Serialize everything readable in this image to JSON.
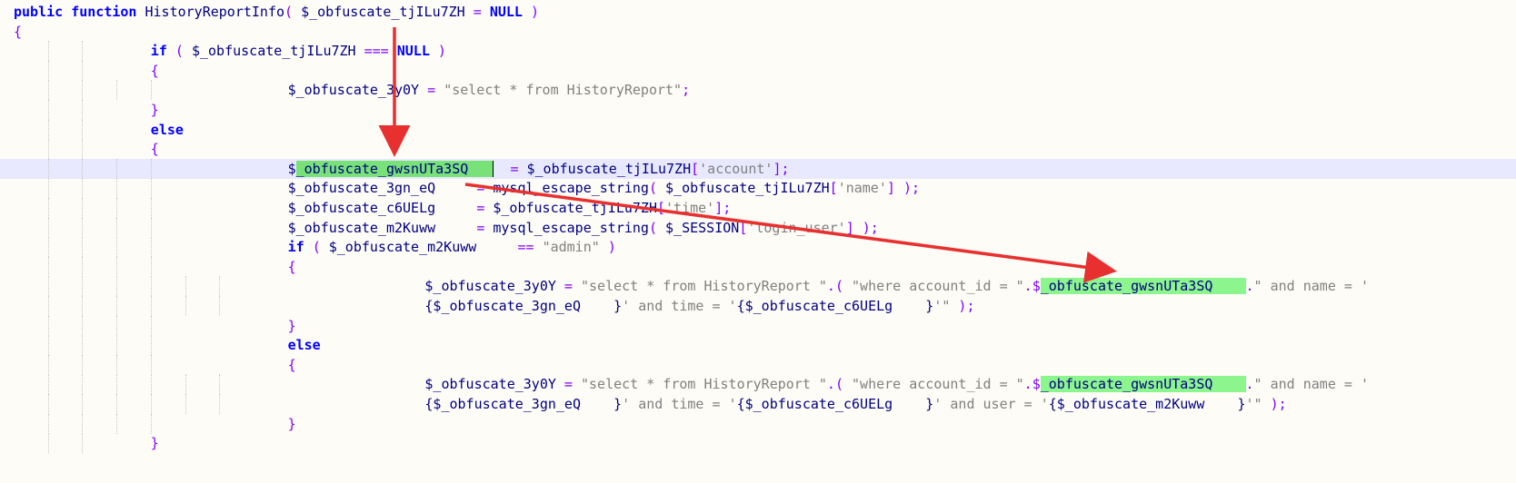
{
  "editor": {
    "lines": [
      {
        "indent": 0,
        "spans": [
          {
            "t": "public ",
            "c": "kw"
          },
          {
            "t": "function ",
            "c": "kw"
          },
          {
            "t": "HistoryReportInfo",
            "c": "fn"
          },
          {
            "t": "( ",
            "c": "br"
          },
          {
            "t": "$_obfuscate_tjILu7ZH ",
            "c": "var"
          },
          {
            "t": "= ",
            "c": "op"
          },
          {
            "t": "NULL ",
            "c": "kw"
          },
          {
            "t": ")",
            "c": "br"
          }
        ]
      },
      {
        "indent": 0,
        "spans": [
          {
            "t": "{",
            "c": "br"
          }
        ]
      },
      {
        "indent": 2,
        "spans": [
          {
            "t": "if ",
            "c": "kw"
          },
          {
            "t": "( ",
            "c": "br"
          },
          {
            "t": "$_obfuscate_tjILu7ZH ",
            "c": "var"
          },
          {
            "t": "=== ",
            "c": "op"
          },
          {
            "t": "NULL ",
            "c": "kw"
          },
          {
            "t": ")",
            "c": "br"
          }
        ]
      },
      {
        "indent": 2,
        "spans": [
          {
            "t": "{",
            "c": "br"
          }
        ]
      },
      {
        "indent": 4,
        "spans": [
          {
            "t": "$_obfuscate_3y0Y ",
            "c": "var"
          },
          {
            "t": "= ",
            "c": "op"
          },
          {
            "t": "\"select * from HistoryReport\"",
            "c": "str"
          },
          {
            "t": ";",
            "c": "op"
          }
        ]
      },
      {
        "indent": 2,
        "spans": [
          {
            "t": "}",
            "c": "br"
          }
        ]
      },
      {
        "indent": 2,
        "spans": [
          {
            "t": "else",
            "c": "kw"
          }
        ]
      },
      {
        "indent": 2,
        "spans": [
          {
            "t": "{",
            "c": "br"
          }
        ]
      },
      {
        "indent": 4,
        "current": true,
        "spans": [
          {
            "t": "$",
            "c": "var"
          },
          {
            "t": "_obfuscate_gwsnUTa3SQ   ",
            "c": "var hl"
          },
          {
            "t": "",
            "c": "caret"
          },
          {
            "t": "  ",
            "c": "var"
          },
          {
            "t": "= ",
            "c": "op"
          },
          {
            "t": "$_obfuscate_tjILu7ZH",
            "c": "var"
          },
          {
            "t": "[",
            "c": "op"
          },
          {
            "t": "'account'",
            "c": "str"
          },
          {
            "t": "]",
            "c": "op"
          },
          {
            "t": ";",
            "c": "op"
          }
        ]
      },
      {
        "indent": 4,
        "spans": [
          {
            "t": "$_obfuscate_3gn_eQ     ",
            "c": "var"
          },
          {
            "t": "= ",
            "c": "op"
          },
          {
            "t": "mysql_escape_string",
            "c": "fn"
          },
          {
            "t": "( ",
            "c": "br"
          },
          {
            "t": "$_obfuscate_tjILu7ZH",
            "c": "var"
          },
          {
            "t": "[",
            "c": "op"
          },
          {
            "t": "'name'",
            "c": "str"
          },
          {
            "t": "] ",
            "c": "op"
          },
          {
            "t": ");",
            "c": "br"
          }
        ]
      },
      {
        "indent": 4,
        "spans": [
          {
            "t": "$_obfuscate_c6UELg     ",
            "c": "var"
          },
          {
            "t": "= ",
            "c": "op"
          },
          {
            "t": "$_obfuscate_tjILu7ZH",
            "c": "var"
          },
          {
            "t": "[",
            "c": "op"
          },
          {
            "t": "'time'",
            "c": "str"
          },
          {
            "t": "]",
            "c": "op"
          },
          {
            "t": ";",
            "c": "op"
          }
        ]
      },
      {
        "indent": 4,
        "spans": [
          {
            "t": "$_obfuscate_m2Kuww     ",
            "c": "var"
          },
          {
            "t": "= ",
            "c": "op"
          },
          {
            "t": "mysql_escape_string",
            "c": "fn"
          },
          {
            "t": "( ",
            "c": "br"
          },
          {
            "t": "$_SESSION",
            "c": "var"
          },
          {
            "t": "[",
            "c": "op"
          },
          {
            "t": "'login_user'",
            "c": "str"
          },
          {
            "t": "] ",
            "c": "op"
          },
          {
            "t": ");",
            "c": "br"
          }
        ]
      },
      {
        "indent": 4,
        "spans": [
          {
            "t": "if ",
            "c": "kw"
          },
          {
            "t": "( ",
            "c": "br"
          },
          {
            "t": "$_obfuscate_m2Kuww     ",
            "c": "var"
          },
          {
            "t": "== ",
            "c": "op"
          },
          {
            "t": "\"admin\" ",
            "c": "str"
          },
          {
            "t": ")",
            "c": "br"
          }
        ]
      },
      {
        "indent": 4,
        "spans": [
          {
            "t": "{",
            "c": "br"
          }
        ]
      },
      {
        "indent": 6,
        "spans": [
          {
            "t": "$_obfuscate_3y0Y ",
            "c": "var"
          },
          {
            "t": "= ",
            "c": "op"
          },
          {
            "t": "\"select * from HistoryReport \"",
            "c": "str"
          },
          {
            "t": ".( ",
            "c": "op"
          },
          {
            "t": "\"where account_id = \"",
            "c": "str"
          },
          {
            "t": ".$",
            "c": "op"
          },
          {
            "t": "_obfuscate_gwsnUTa3SQ    ",
            "c": "var hl2"
          },
          {
            "t": ".",
            "c": "op"
          },
          {
            "t": "\" and name = '",
            "c": "str"
          }
        ]
      },
      {
        "indent": 6,
        "spans": [
          {
            "t": "{$_obfuscate_3gn_eQ    }",
            "c": "var"
          },
          {
            "t": "' and time = '",
            "c": "str"
          },
          {
            "t": "{$_obfuscate_c6UELg    }",
            "c": "var"
          },
          {
            "t": "'\" ",
            "c": "str"
          },
          {
            "t": ");",
            "c": "br"
          }
        ]
      },
      {
        "indent": 4,
        "spans": [
          {
            "t": "}",
            "c": "br"
          }
        ]
      },
      {
        "indent": 4,
        "spans": [
          {
            "t": "else",
            "c": "kw"
          }
        ]
      },
      {
        "indent": 4,
        "spans": [
          {
            "t": "{",
            "c": "br"
          }
        ]
      },
      {
        "indent": 6,
        "spans": [
          {
            "t": "$_obfuscate_3y0Y ",
            "c": "var"
          },
          {
            "t": "= ",
            "c": "op"
          },
          {
            "t": "\"select * from HistoryReport \"",
            "c": "str"
          },
          {
            "t": ".( ",
            "c": "op"
          },
          {
            "t": "\"where account_id = \"",
            "c": "str"
          },
          {
            "t": ".$",
            "c": "op"
          },
          {
            "t": "_obfuscate_gwsnUTa3SQ    ",
            "c": "var hl2"
          },
          {
            "t": ".",
            "c": "op"
          },
          {
            "t": "\" and name = '",
            "c": "str"
          }
        ]
      },
      {
        "indent": 6,
        "spans": [
          {
            "t": "{$_obfuscate_3gn_eQ    }",
            "c": "var"
          },
          {
            "t": "' and time = '",
            "c": "str"
          },
          {
            "t": "{$_obfuscate_c6UELg    }",
            "c": "var"
          },
          {
            "t": "' and user = '",
            "c": "str"
          },
          {
            "t": "{$_obfuscate_m2Kuww    }",
            "c": "var"
          },
          {
            "t": "'\" ",
            "c": "str"
          },
          {
            "t": ");",
            "c": "br"
          }
        ]
      },
      {
        "indent": 4,
        "spans": [
          {
            "t": "}",
            "c": "br"
          }
        ]
      },
      {
        "indent": 2,
        "spans": [
          {
            "t": "}",
            "c": "br"
          }
        ]
      }
    ]
  },
  "annotations": {
    "arrow_color": "#e83030"
  }
}
